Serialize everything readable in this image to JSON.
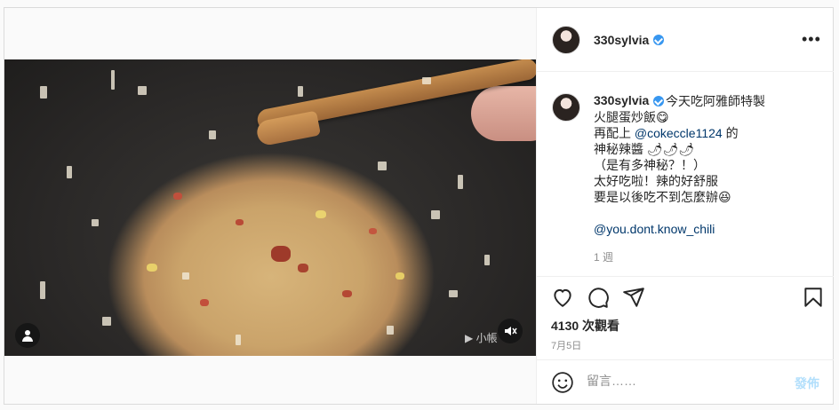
{
  "post": {
    "username": "330sylvia",
    "caption_lines": [
      "今天吃阿雅師特製",
      "火腿蛋炒飯😋",
      "神秘辣醬 🌶🌶🌶",
      "（是有多神秘？！）",
      "太好吃啦！辣的好舒服",
      "要是以後吃不到怎麼辦😆"
    ],
    "caption_line3_prefix": "再配上 ",
    "caption_mention_1": "@cokeccle1124",
    "caption_line3_suffix": " 的",
    "caption_mention_2": "@you.dont.know_chili",
    "time_ago": "1 週",
    "views": "4130 次觀看",
    "date": "7月5日"
  },
  "video": {
    "watermark": "▶ 小帳"
  },
  "comment": {
    "placeholder": "留言……",
    "post_label": "發佈"
  },
  "icons": {
    "more": "more-icon",
    "like": "heart-icon",
    "comment": "comment-icon",
    "share": "share-icon",
    "save": "bookmark-icon",
    "emoji": "emoji-icon",
    "mute": "mute-icon",
    "tagged_user": "user-icon"
  },
  "colors": {
    "verified": "#3897f0",
    "mention": "#00376b",
    "post_button_disabled": "#b2dffc"
  }
}
